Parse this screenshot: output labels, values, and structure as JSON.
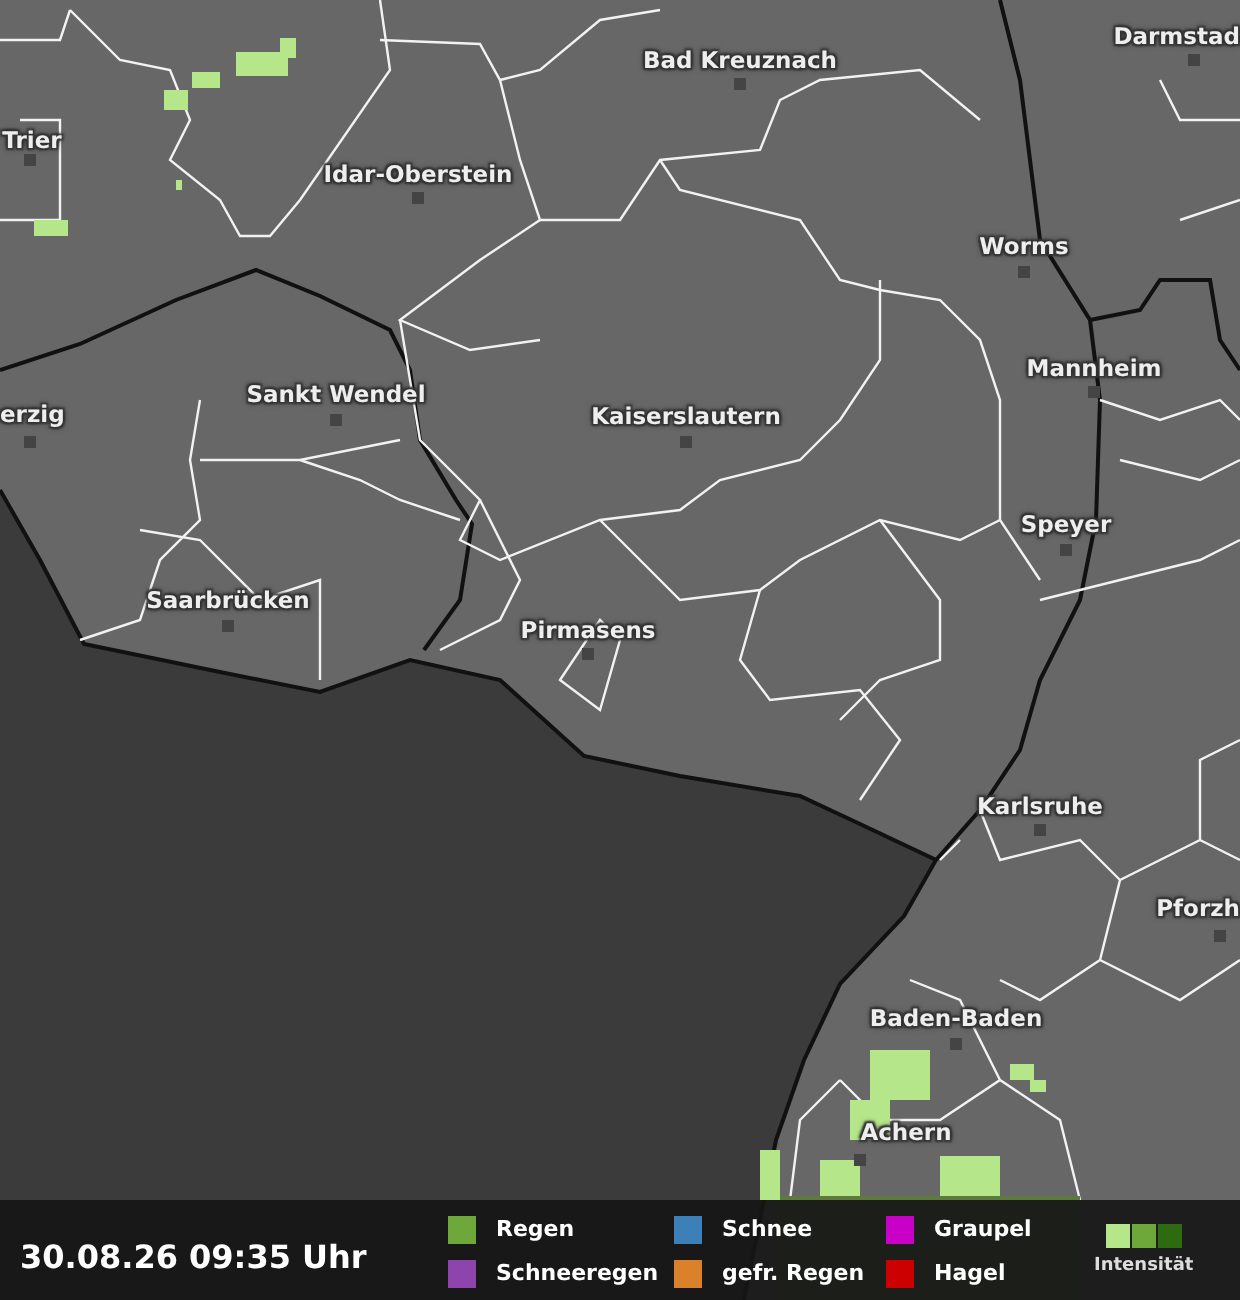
{
  "map": {
    "cities": [
      {
        "name": "Trier"
      },
      {
        "name": "Bad Kreuznach"
      },
      {
        "name": "Darmstad"
      },
      {
        "name": "Idar-Oberstein"
      },
      {
        "name": "Worms"
      },
      {
        "name": "erzig"
      },
      {
        "name": "Sankt Wendel"
      },
      {
        "name": "Kaiserslautern"
      },
      {
        "name": "Mannheim"
      },
      {
        "name": "Speyer"
      },
      {
        "name": "Saarbrücken"
      },
      {
        "name": "Pirmasens"
      },
      {
        "name": "Karlsruhe"
      },
      {
        "name": "Pforzh"
      },
      {
        "name": "Baden-Baden"
      },
      {
        "name": "Achern"
      }
    ]
  },
  "status_bar": {
    "timestamp": "30.08.26 09:35 Uhr",
    "legend": [
      {
        "label": "Regen",
        "color": "#6ea83a"
      },
      {
        "label": "Schnee",
        "color": "#3d80b8"
      },
      {
        "label": "Graupel",
        "color": "#c800c8"
      },
      {
        "label": "Schneeregen",
        "color": "#8e44ad"
      },
      {
        "label": "gefr. Regen",
        "color": "#d9822b"
      },
      {
        "label": "Hagel",
        "color": "#cc0000"
      }
    ],
    "intensity": {
      "label": "Intensität",
      "levels": [
        {
          "color": "#b5e68a"
        },
        {
          "color": "#6ea83a"
        },
        {
          "color": "#2e6b10"
        }
      ]
    }
  }
}
